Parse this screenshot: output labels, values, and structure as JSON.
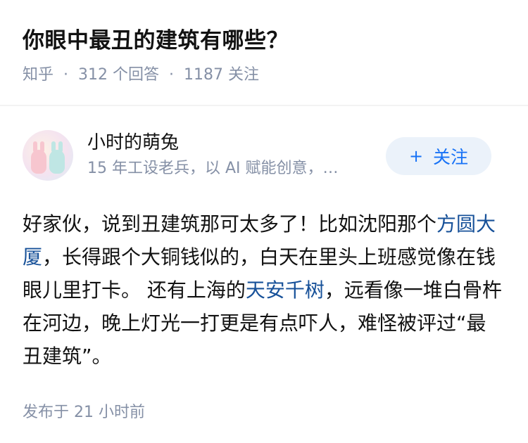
{
  "question": {
    "title": "你眼中最丑的建筑有哪些？",
    "source": "知乎",
    "answers": "312 个回答",
    "followers": "1187 关注",
    "separator": "·"
  },
  "author": {
    "name": "小时的萌兔",
    "bio": "15 年工设老兵，以 AI 赋能创意，…",
    "avatar_icon": "bunny-avatar-icon"
  },
  "follow_button": {
    "plus": "+",
    "label": "关注",
    "color": "#1772f6",
    "bg": "#ebf2fa"
  },
  "answer": {
    "part1": "好家伙，说到丑建筑那可太多了！比如沈阳那个",
    "link1": "方圆大厦",
    "part2": "，长得跟个大铜钱似的，白天在里头上班感觉像在钱眼儿里打卡。 还有上海的",
    "link2": "天安千树",
    "part3": "，远看像一堆白骨杵在河边，晚上灯光一打更是有点吓人，难怪被评过“最丑建筑”。",
    "link_color": "#175199"
  },
  "footer": {
    "published": "发布于  21 小时前"
  }
}
